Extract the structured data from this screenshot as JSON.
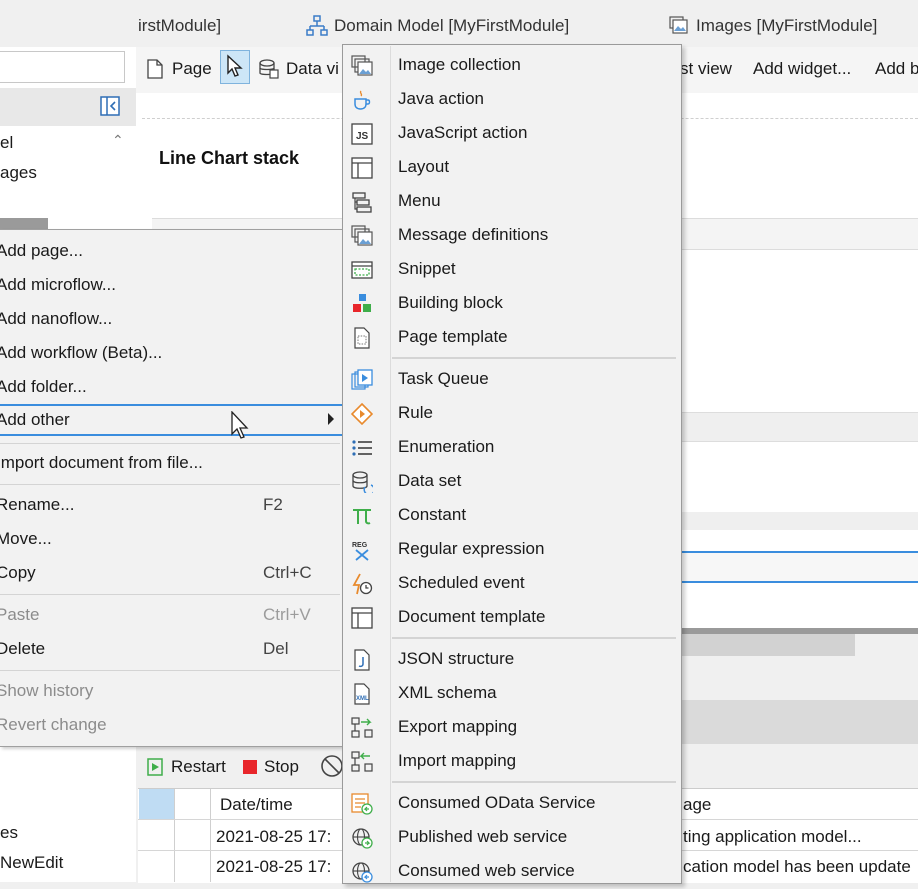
{
  "tabs": [
    {
      "label": "irstModule]"
    },
    {
      "label": "Domain Model [MyFirstModule]"
    },
    {
      "label": "Images [MyFirstModule]"
    }
  ],
  "toolbar": {
    "page_label": "Page",
    "dataview_label": "Data vi",
    "listview_label": "st view",
    "add_widget_label": "Add widget...",
    "add_b_label": "Add b"
  },
  "explorer": {
    "items": [
      {
        "label": "el"
      },
      {
        "label": "ages"
      }
    ]
  },
  "canvas": {
    "title": "Line Chart stack"
  },
  "context_menu": {
    "items": [
      {
        "label": "Add page..."
      },
      {
        "label": "Add microflow..."
      },
      {
        "label": "Add nanoflow..."
      },
      {
        "label": "Add workflow (Beta)..."
      },
      {
        "label": "Add folder..."
      },
      {
        "label": "Add other"
      },
      {
        "label": "Import document from file..."
      },
      {
        "label": "Rename...",
        "shortcut": "F2"
      },
      {
        "label": "Move..."
      },
      {
        "label": "Copy",
        "shortcut": "Ctrl+C"
      },
      {
        "label": "Paste",
        "shortcut": "Ctrl+V"
      },
      {
        "label": "Delete",
        "shortcut": "Del"
      },
      {
        "label": "Show history"
      },
      {
        "label": "Revert change"
      }
    ]
  },
  "submenu": {
    "items": [
      {
        "label": "Image collection",
        "icon": "image-collection-icon"
      },
      {
        "label": "Java action",
        "icon": "java-action-icon"
      },
      {
        "label": "JavaScript action",
        "icon": "javascript-action-icon"
      },
      {
        "label": "Layout",
        "icon": "layout-icon"
      },
      {
        "label": "Menu",
        "icon": "menu-icon"
      },
      {
        "label": "Message definitions",
        "icon": "message-definitions-icon"
      },
      {
        "label": "Snippet",
        "icon": "snippet-icon"
      },
      {
        "label": "Building block",
        "icon": "building-block-icon"
      },
      {
        "label": "Page template",
        "icon": "page-template-icon"
      },
      {
        "label": "Task Queue",
        "icon": "task-queue-icon"
      },
      {
        "label": "Rule",
        "icon": "rule-icon"
      },
      {
        "label": "Enumeration",
        "icon": "enumeration-icon"
      },
      {
        "label": "Data set",
        "icon": "data-set-icon"
      },
      {
        "label": "Constant",
        "icon": "constant-icon"
      },
      {
        "label": "Regular expression",
        "icon": "regular-expression-icon"
      },
      {
        "label": "Scheduled event",
        "icon": "scheduled-event-icon"
      },
      {
        "label": "Document template",
        "icon": "document-template-icon"
      },
      {
        "label": "JSON structure",
        "icon": "json-structure-icon"
      },
      {
        "label": "XML schema",
        "icon": "xml-schema-icon"
      },
      {
        "label": "Export mapping",
        "icon": "export-mapping-icon"
      },
      {
        "label": "Import mapping",
        "icon": "import-mapping-icon"
      },
      {
        "label": "Consumed OData Service",
        "icon": "consumed-odata-service-icon"
      },
      {
        "label": "Published web service",
        "icon": "published-web-service-icon"
      },
      {
        "label": "Consumed web service",
        "icon": "consumed-web-service-icon"
      }
    ]
  },
  "console": {
    "restart_label": "Restart",
    "stop_label": "Stop",
    "columns": {
      "datetime": "Date/time",
      "message": "age"
    },
    "rows": [
      {
        "datetime": "2021-08-25 17:",
        "message": "ting application model..."
      },
      {
        "datetime": "2021-08-25 17:",
        "message": "cation model has been update"
      }
    ]
  },
  "left_lower": {
    "items": [
      {
        "label": "es"
      },
      {
        "label": "NewEdit"
      }
    ]
  },
  "colors": {
    "accent": "#3a8dde",
    "menu_bg": "#f2f2f2",
    "stop_red": "#e8262b",
    "restart_green": "#3fae4a"
  }
}
